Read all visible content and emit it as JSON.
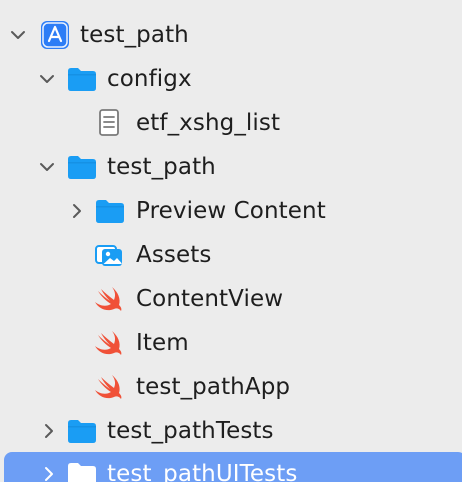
{
  "navigator": {
    "project": {
      "label": "test_path",
      "icon": "app-store-project-icon",
      "expanded": true
    },
    "group_configx": {
      "label": "configx",
      "icon": "folder-icon",
      "expanded": true
    },
    "file_etf": {
      "label": "etf_xshg_list",
      "icon": "document-icon"
    },
    "group_test_path": {
      "label": "test_path",
      "icon": "folder-icon",
      "expanded": true
    },
    "group_preview": {
      "label": "Preview Content",
      "icon": "folder-icon",
      "expanded": false
    },
    "file_assets": {
      "label": "Assets",
      "icon": "asset-catalog-icon"
    },
    "file_contentview": {
      "label": "ContentView",
      "icon": "swift-icon"
    },
    "file_item": {
      "label": "Item",
      "icon": "swift-icon"
    },
    "file_app": {
      "label": "test_pathApp",
      "icon": "swift-icon"
    },
    "group_tests": {
      "label": "test_pathTests",
      "icon": "folder-icon",
      "expanded": false
    },
    "group_uitests": {
      "label": "test_pathUITests",
      "icon": "folder-icon",
      "expanded": false,
      "selected": true
    }
  },
  "colors": {
    "background": "#ececec",
    "folder": "#1a9df4",
    "swift": "#f05138",
    "selection": "#6d9ef5",
    "app_icon": "#2d7df6"
  }
}
